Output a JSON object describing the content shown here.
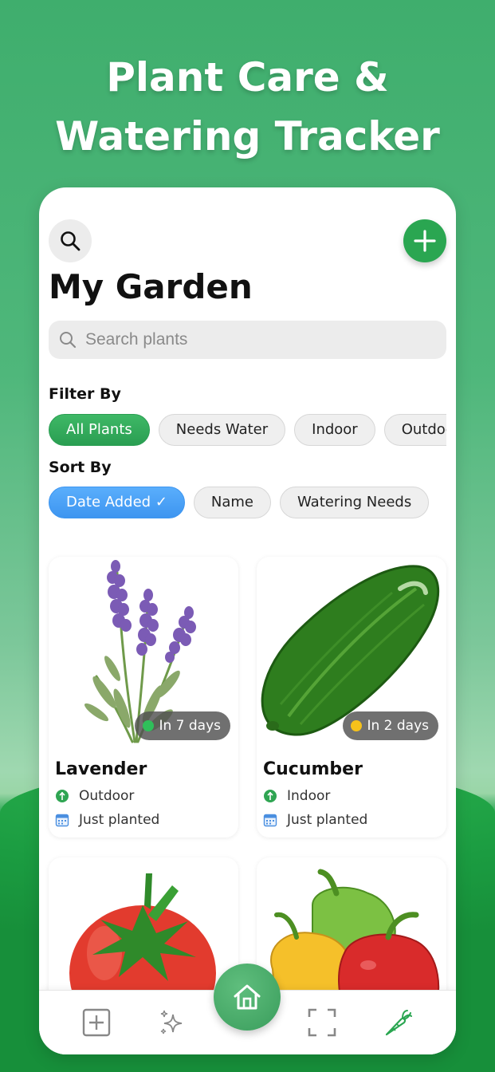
{
  "hero": {
    "line1": "Plant Care &",
    "line2": "Watering Tracker"
  },
  "header": {
    "title": "My Garden"
  },
  "search": {
    "placeholder": "Search plants"
  },
  "filter": {
    "label": "Filter By",
    "chips": [
      "All Plants",
      "Needs Water",
      "Indoor",
      "Outdoor"
    ],
    "selected": "All Plants"
  },
  "sort": {
    "label": "Sort By",
    "chips": [
      "Date Added ✓",
      "Name",
      "Watering Needs"
    ],
    "selected": "Date Added ✓"
  },
  "plants": [
    {
      "name": "Lavender",
      "badge": "In 7 days",
      "badge_color": "#2fbf5a",
      "location": "Outdoor",
      "planted": "Just planted",
      "icon": "lavender-image"
    },
    {
      "name": "Cucumber",
      "badge": "In 2 days",
      "badge_color": "#f6c21b",
      "location": "Indoor",
      "planted": "Just planted",
      "icon": "cucumber-image"
    },
    {
      "name": "",
      "icon": "tomato-image"
    },
    {
      "name": "",
      "icon": "peppers-image"
    }
  ],
  "nav": {
    "items": [
      "add-plant-icon",
      "sparkles-icon",
      "home-icon",
      "scan-icon",
      "carrot-icon"
    ],
    "active": "home-icon"
  },
  "colors": {
    "brand_green": "#2aa651",
    "sort_blue": "#3d95f0",
    "water_soon": "#f6c21b",
    "water_later": "#2fbf5a"
  }
}
